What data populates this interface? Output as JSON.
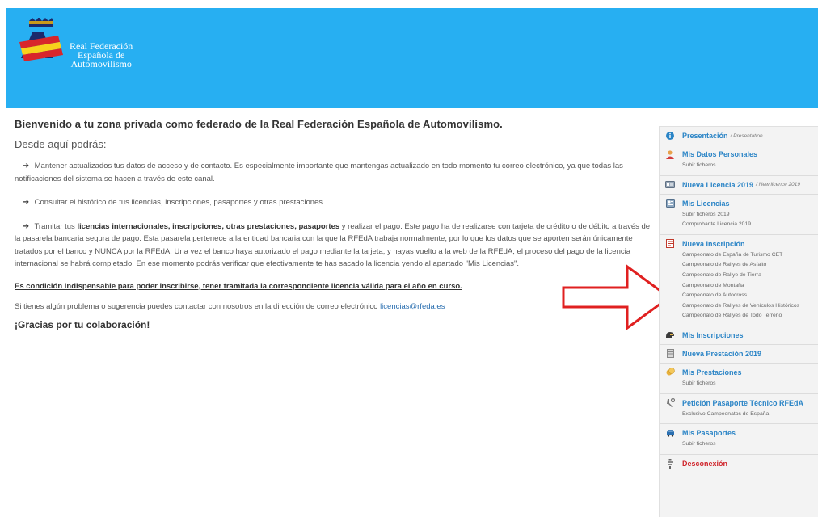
{
  "header": {
    "bg_color": "#27aff2",
    "logo_lines": [
      "Real Federación",
      "Española de",
      "Automovilismo"
    ]
  },
  "main": {
    "welcome": "Bienvenido a tu zona privada como federado de la Real Federación Española de Automovilismo.",
    "subtitle": "Desde aquí podrás:",
    "p1": "Mantener actualizados tus datos de acceso y de contacto. Es especialmente importante que mantengas actualizado en todo momento tu correo electrónico, ya que todas las notificaciones del sistema se hacen a través de este canal.",
    "p2": "Consultar el histórico de tus licencias, inscripciones, pasaportes y otras prestaciones.",
    "p3_pre": "Tramitar tus",
    "p3_bold": "licencias internacionales, inscripciones, otras prestaciones, pasaportes",
    "p3_post": "y realizar el pago. Este pago ha de realizarse con tarjeta de crédito o de débito a través de la pasarela bancaria segura de pago. Esta pasarela pertenece a la entidad bancaria con la que la RFEdA trabaja normalmente, por lo que los datos que se aporten serán únicamente tratados por el banco y NUNCA por la RFEdA. Una vez el banco haya autorizado el pago mediante la tarjeta, y hayas vuelto a la web de la RFEdA, el proceso del pago de la licencia internacional se habrá completado. En ese momento podrás verificar que efectivamente te has sacado la licencia yendo al apartado \"Mis Licencias\".",
    "condition": "Es condición indispensable para poder inscribirse, tener tramitada la correspondiente licencia válida para el año en curso.",
    "contact_pre": "Si tienes algún problema o sugerencia puedes contactar con nosotros en la dirección de correo electrónico",
    "contact_email": "licencias@rfeda.es",
    "thanks": "¡Gracias por tu colaboración!"
  },
  "sidebar": {
    "presentacion": {
      "label": "Presentación",
      "note": "/ Presentation"
    },
    "datos": {
      "label": "Mis Datos Personales",
      "subs": [
        "Subir ficheros"
      ]
    },
    "nueva_licencia": {
      "label": "Nueva Licencia 2019",
      "note": "/ New licence 2019"
    },
    "licencias": {
      "label": "Mis Licencias",
      "subs": [
        "Subir ficheros 2019",
        "Comprobante Licencia 2019"
      ]
    },
    "nueva_inscripcion": {
      "label": "Nueva Inscripción",
      "subs": [
        "Campeonato de España de Turismo CET",
        "Campeonato de Rallyes de Asfalto",
        "Campeonato de Rallye de Tierra",
        "Campeonato de Montaña",
        "Campeonato de Autocross",
        "Campeonato de Rallyes de Vehículos Históricos",
        "Campeonato de Rallyes de Todo Terreno"
      ]
    },
    "inscripciones": {
      "label": "Mis Inscripciones"
    },
    "nueva_prestacion": {
      "label": "Nueva Prestación 2019"
    },
    "prestaciones": {
      "label": "Mis Prestaciones",
      "subs": [
        "Subir ficheros"
      ]
    },
    "pasaporte": {
      "label": "Petición Pasaporte Técnico RFEdA",
      "subs": [
        "Exclusivo Campeonatos de España"
      ]
    },
    "pasaportes": {
      "label": "Mis Pasaportes",
      "subs": [
        "Subir ficheros"
      ]
    },
    "desconexion": {
      "label": "Desconexión"
    }
  },
  "colors": {
    "link": "#2a84c6",
    "danger": "#d0262d",
    "arrow": "#e02020"
  }
}
